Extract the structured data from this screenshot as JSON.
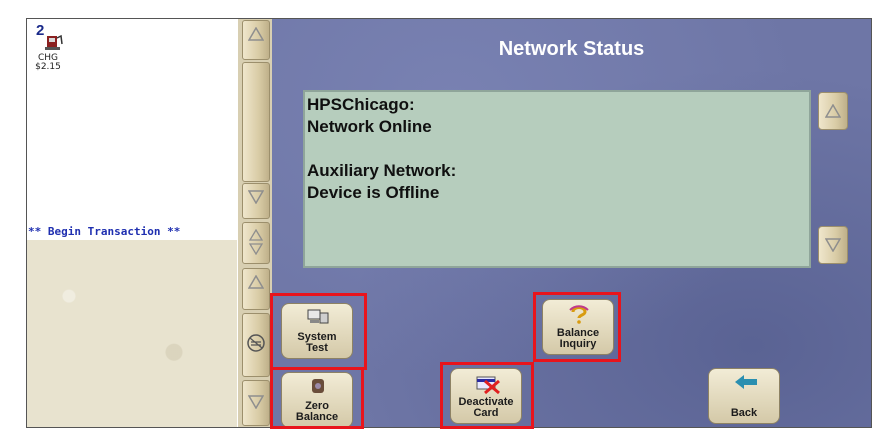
{
  "pos": {
    "pump_number": "2",
    "pump_label": "CHG",
    "pump_amount": "$2.15",
    "begin_text": "** Begin Transaction **"
  },
  "screen": {
    "title": "Network Status",
    "status_text": "HPSChicago:\nNetwork Online\n\nAuxiliary Network:\nDevice is Offline"
  },
  "buttons": {
    "system_test": "System\nTest",
    "balance_inquiry": "Balance\nInquiry",
    "zero_balance": "Zero\nBalance",
    "deactivate_card": "Deactivate\nCard",
    "back": "Back"
  },
  "colors": {
    "highlight": "#e8141c",
    "screen_bg": "#6e76a6",
    "status_bg": "#b6cdbd"
  }
}
